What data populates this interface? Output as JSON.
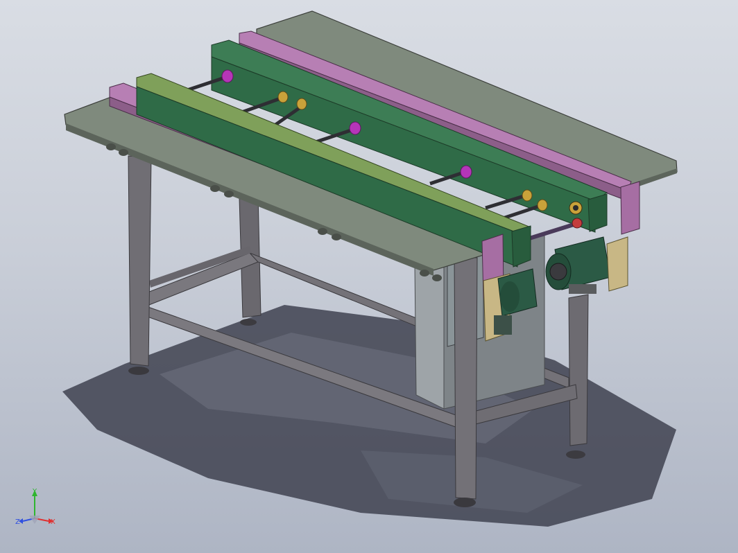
{
  "viewport": {
    "background_top": "#d9dde4",
    "background_bottom": "#aeb5c4"
  },
  "model": {
    "frame_color": "#77757b",
    "frame_dark": "#5d5b61",
    "top_plate_color": "#7f8a7d",
    "rail_pink": "#b77fb4",
    "rail_green": "#2f6b47",
    "rail_lime": "#7fa05a",
    "shaft_color": "#2e2e33",
    "collar_color": "#b535b8",
    "motor_color": "#2b5a45",
    "cabinet_color": "#8a8f92"
  },
  "axis_triad": {
    "labels": {
      "x": "X",
      "y": "Y",
      "z": "Z"
    },
    "colors": {
      "x": "#e03030",
      "y": "#2fb52f",
      "z": "#3050e0"
    }
  }
}
